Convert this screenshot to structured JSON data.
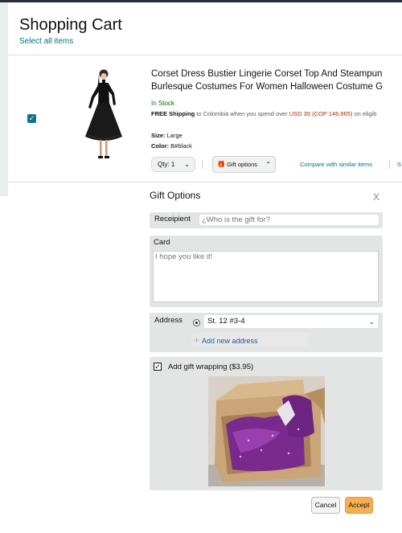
{
  "page": {
    "title": "Shopping Cart",
    "select_all": "Select all items"
  },
  "item": {
    "checked": true,
    "title_line1": "Corset Dress Bustier Lingerie Corset Top And Steampun",
    "title_line2": "Burlesque Costumes For Women Halloween Costume G",
    "stock": "In Stock",
    "shipping_free": "FREE Shipping",
    "shipping_mid": " to Colombia when you spend over ",
    "shipping_amount": "USD 35 (COP 146,965)",
    "shipping_tail": " on eligib",
    "size_label": "Size:",
    "size_value": " Large",
    "color_label": "Color:",
    "color_value": " B#black",
    "qty_label": "Qty:",
    "qty_value": "1",
    "gift_options_label": "Gift options",
    "compare_label": "Compare with similar items",
    "share_label": "S"
  },
  "gift_options": {
    "title": "Gift Options",
    "close": "X",
    "recipient_label": "Receipient",
    "recipient_placeholder": "¿Who is the gift for?",
    "card_label": "Card",
    "card_placeholder": "I hope you like it!",
    "address_label": "Address",
    "address_value": "St. 12 #3-4",
    "add_address": "Add new address",
    "wrapping_checked": true,
    "wrapping_label": "Add gift wrapping ($3.95)",
    "cancel": "Cancel",
    "accept": "Accept"
  },
  "colors": {
    "link": "#007185",
    "accent": "#f7ae4f",
    "in_stock": "#007600",
    "price": "#b12704"
  }
}
